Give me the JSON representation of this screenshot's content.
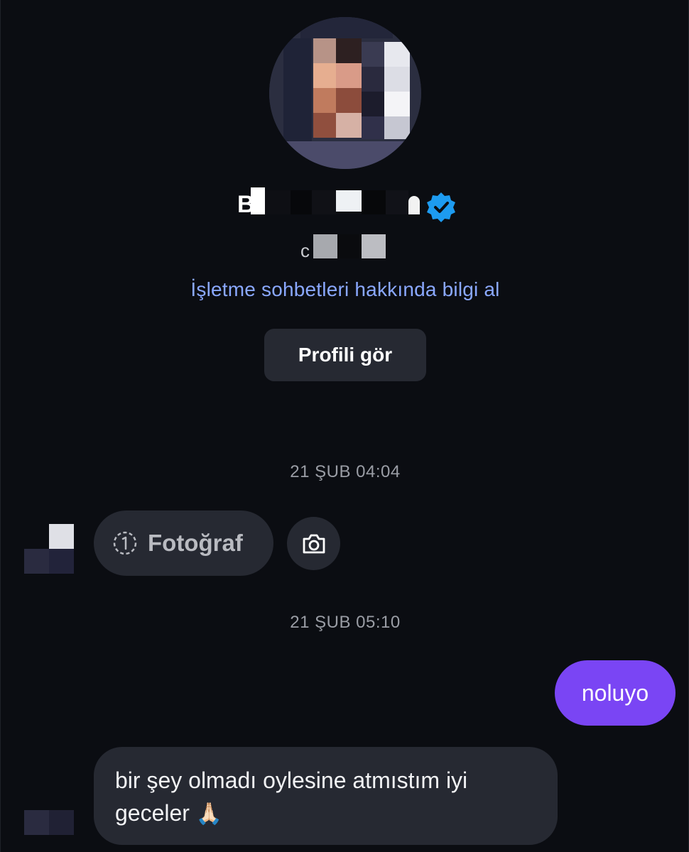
{
  "profile": {
    "avatar_icon": "profile-photo-pixelated",
    "name_visible_start": "B",
    "verified_icon": "verified-badge-icon",
    "verified_color": "#1d9bf0",
    "handle_visible_start": "c",
    "business_info_link": "İşletme sohbetleri hakkında bilgi al",
    "view_profile_button": "Profili gör"
  },
  "conversation": {
    "timestamps": [
      "21 ŞUB 04:04",
      "21 ŞUB 05:10"
    ],
    "view_once_photo": {
      "label": "Fotoğraf",
      "icon": "view-once-icon",
      "action_icon": "camera-icon"
    },
    "sent_message": {
      "text": "noluyo",
      "color": "#7a45f4"
    },
    "received_message": {
      "text": "bir şey olmadı oylesine atmıstım iyi geceler",
      "emoji": "🙏🏻"
    }
  },
  "theme": {
    "background": "#0b0d12",
    "bubble_gray": "#262932",
    "link_blue": "#8aa8ff"
  }
}
